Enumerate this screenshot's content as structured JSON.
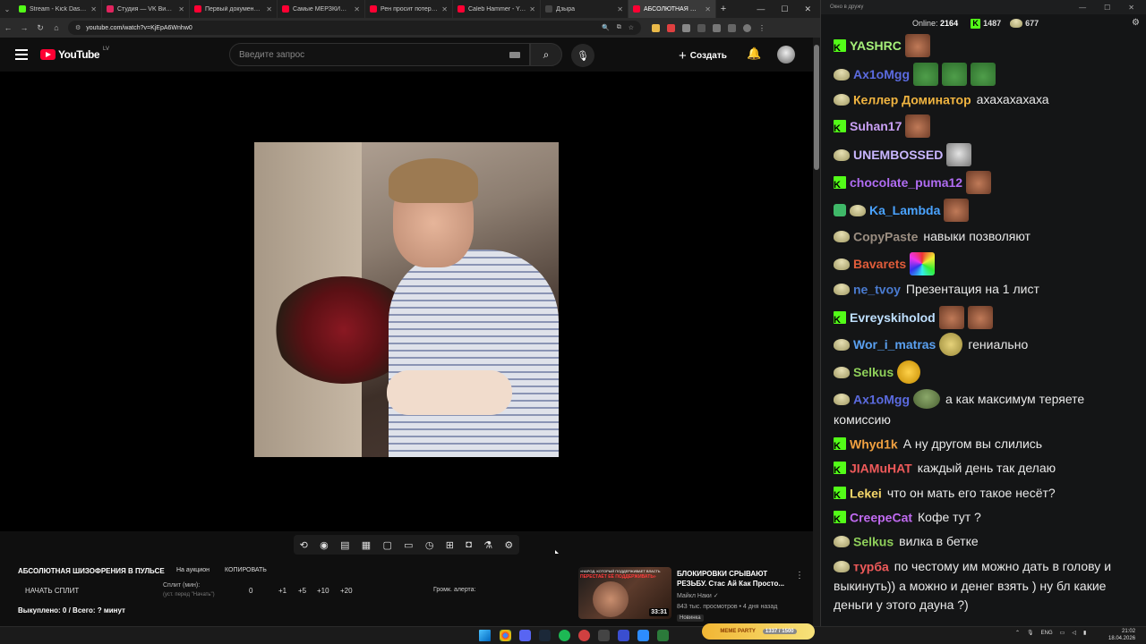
{
  "browser": {
    "tabs": [
      {
        "title": "Stream - Kick Dashboard",
        "color": "#53fc18"
      },
      {
        "title": "Студия — VK Видео Live",
        "color": "#e0245e"
      },
      {
        "title": "Первый документальный",
        "color": "#ff0033"
      },
      {
        "title": "Самые МЕРЗКИЕ форумы",
        "color": "#ff0033"
      },
      {
        "title": "Рен просит потерпеть",
        "color": "#ff0033"
      },
      {
        "title": "Caleb Hammer - YouTube",
        "color": "#ff0033"
      },
      {
        "title": "Дзыра",
        "color": "#444444"
      },
      {
        "title": "АБСОЛЮТНАЯ ШИЗОФРЕНИЯ",
        "color": "#ff0033"
      }
    ],
    "url": "youtube.com/watch?v=KjEpA6Wnhw0"
  },
  "youtube": {
    "logo_text": "YouTube",
    "country": "LV",
    "search_placeholder": "Введите запрос",
    "create_label": "Создать"
  },
  "toolbar_icons": [
    "loop-icon",
    "audio-icon",
    "screenshot-list-icon",
    "clapper-icon",
    "frame-icon",
    "film-icon",
    "speed-icon",
    "pip-icon",
    "camera-icon",
    "flask-icon",
    "settings-icon"
  ],
  "panel": {
    "title": "АБСОЛЮТНАЯ ШИЗОФРЕНИЯ В ПУЛЬСЕ",
    "auction": "На аукцион",
    "copy": "КОПИРОВАТЬ",
    "start_split": "НАЧАТЬ СПЛИТ",
    "split_label": "Сплит (мин):",
    "split_hint": "(уст. перед \"Начать\")",
    "split_value": "0",
    "increments": [
      "+1",
      "+5",
      "+10",
      "+20"
    ],
    "alert_label": "Громк. алерта:",
    "bought": "Выкуплено: 0 / Всего: ? минут"
  },
  "recommendation": {
    "thumb_caption": "«НАРОД, КОТОРЫЙ ПОДДЕРЖИВАЕТ ВЛАСТЬ",
    "thumb_caption2": "ПЕРЕСТАЁТ ЕЁ ПОДДЕРЖИВАТЬ»",
    "duration": "33:31",
    "title": "БЛОКИРОВКИ СРЫВАЮТ РЕЗЬБУ. Стас Ай Как Просто...",
    "channel": "Майкл Наки",
    "views": "843 тыс. просмотров • 4 дня назад",
    "badge": "Новинка"
  },
  "chat": {
    "window_title": "Окно в дружу",
    "online_label": "Online:",
    "online_value": "2164",
    "kick_count": "1487",
    "other_count": "677",
    "messages": [
      {
        "platform": "kick",
        "user": "YASHRC",
        "color": "#a6f07a",
        "text": "",
        "emotes": [
          "face"
        ]
      },
      {
        "platform": "twitch",
        "user": "Ax1oMgg",
        "color": "#5b6be0",
        "text": "",
        "emotes": [
          "pepe",
          "pepe",
          "pepe"
        ]
      },
      {
        "platform": "twitch",
        "user": "Келлер Доминатор",
        "color": "#f0b440",
        "text": "ахахахахаха",
        "emotes": []
      },
      {
        "platform": "kick",
        "user": "Suhan17",
        "color": "#c9a0f5",
        "text": "",
        "emotes": [
          "face"
        ]
      },
      {
        "platform": "twitch",
        "user": "UNEMBOSSED",
        "color": "#c9b6ff",
        "text": "",
        "emotes": [
          "man"
        ]
      },
      {
        "platform": "kick",
        "user": "chocolate_puma12",
        "color": "#b06cf2",
        "text": "",
        "emotes": [
          "face"
        ]
      },
      {
        "platform": "both",
        "user": "Ka_Lambda",
        "color": "#4aa3ff",
        "text": "",
        "emotes": [
          "face"
        ]
      },
      {
        "platform": "twitch",
        "user": "CopyPaste",
        "color": "#9a8d80",
        "text": "навыки позволяют",
        "emotes": []
      },
      {
        "platform": "twitch",
        "user": "Bavarets",
        "color": "#e05c3a",
        "text": "",
        "emotes": [
          "rain"
        ]
      },
      {
        "platform": "twitch",
        "user": "ne_tvoy",
        "color": "#4a7bd0",
        "text": "Презентация на 1 лист",
        "emotes": []
      },
      {
        "platform": "kick",
        "user": "Evreyskiholod",
        "color": "#bfe0ff",
        "text": "",
        "emotes": [
          "face",
          "face"
        ]
      },
      {
        "platform": "twitch",
        "user": "Wor_i_matras",
        "color": "#5aa0f0",
        "text": "гениально",
        "emotes": [
          "round"
        ]
      },
      {
        "platform": "twitch",
        "user": "Selkus",
        "color": "#8fd05a",
        "text": "",
        "emotes": [
          "laugh"
        ]
      },
      {
        "platform": "twitch",
        "user": "Ax1oMgg",
        "color": "#5b6be0",
        "text": "а как максимум теряете комиссию",
        "emotes": [
          "frog"
        ]
      },
      {
        "platform": "kick",
        "user": "Whyd1k",
        "color": "#f0a040",
        "text": "А ну другом вы слились",
        "emotes": []
      },
      {
        "platform": "kick",
        "user": "JIAMuHAT",
        "color": "#ef5a5a",
        "text": "каждый день так делаю",
        "emotes": []
      },
      {
        "platform": "kick",
        "user": "Lekei",
        "color": "#f5d76a",
        "text": "что он мать его такое несёт?",
        "emotes": []
      },
      {
        "platform": "kick",
        "user": "CreepeCat",
        "color": "#c06af0",
        "text": "Кофе тут ?",
        "emotes": []
      },
      {
        "platform": "twitch",
        "user": "Selkus",
        "color": "#8fd05a",
        "text": "вилка в бетке",
        "emotes": []
      },
      {
        "platform": "twitch",
        "user": "турба",
        "color": "#ef5a5a",
        "text": "по честому им можно дать в голову и выкинуть)) а можно и денег взять ) ну бл какие деньги у этого дауна ?)",
        "emotes": []
      }
    ]
  },
  "taskbar": {
    "meme_label": "MEME PARTY",
    "meme_score": "1337 / 1500",
    "lang": "ENG",
    "time": "21:02",
    "date": "18.04.2026"
  }
}
